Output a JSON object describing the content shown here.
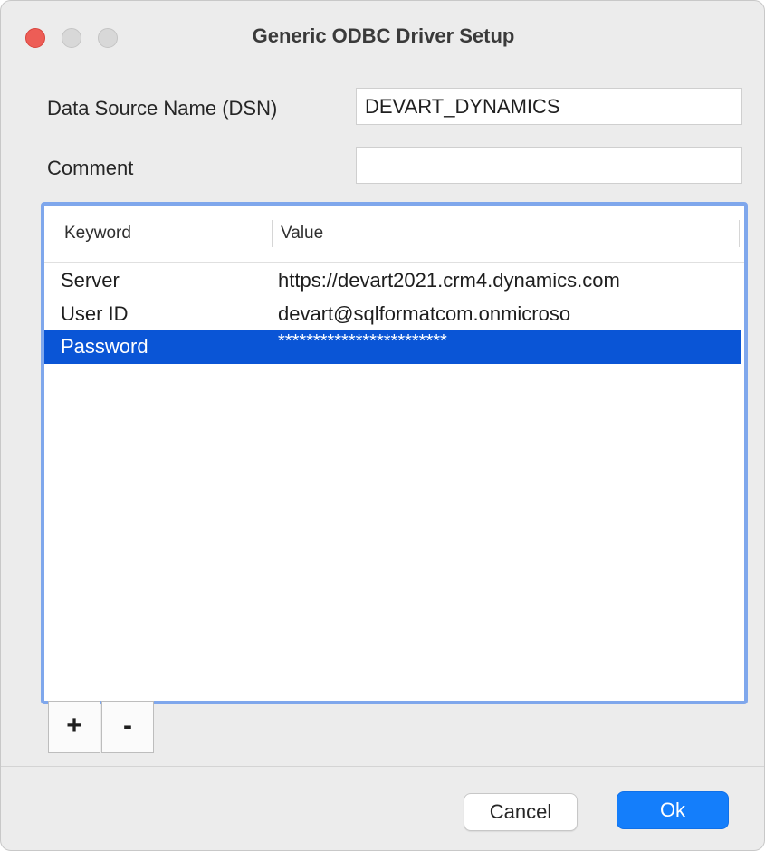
{
  "window": {
    "title": "Generic ODBC Driver Setup"
  },
  "form": {
    "dsn_label": "Data Source Name (DSN)",
    "dsn_value": "DEVART_DYNAMICS",
    "comment_label": "Comment",
    "comment_value": ""
  },
  "table": {
    "columns": [
      "Keyword",
      "Value"
    ],
    "rows": [
      {
        "keyword": "Server",
        "value": "https://devart2021.crm4.dynamics.com",
        "selected": false
      },
      {
        "keyword": "User ID",
        "value": "devart@sqlformatcom.onmicroso",
        "selected": false
      },
      {
        "keyword": "Password",
        "value": "************************",
        "selected": true
      }
    ]
  },
  "table_controls": {
    "add_label": "+",
    "remove_label": "-"
  },
  "buttons": {
    "cancel_label": "Cancel",
    "ok_label": "Ok"
  },
  "colors": {
    "accent": "#147efb",
    "selection": "#0a55d6",
    "focus_ring": "#7fa7ec",
    "close_button": "#ed5d56"
  }
}
